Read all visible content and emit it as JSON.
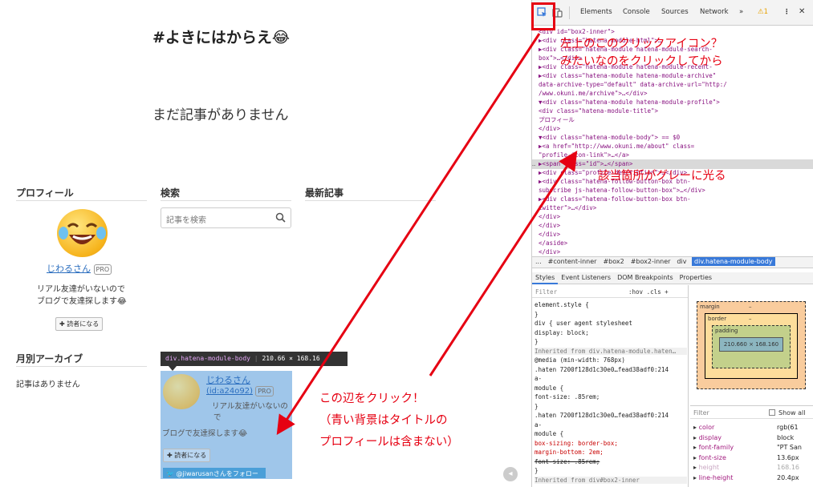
{
  "blog": {
    "title": "#よきにはからえ😂",
    "no_articles": "まだ記事がありません",
    "sidebar": {
      "profile_title": "プロフィール",
      "search_title": "検索",
      "recent_title": "最新記事",
      "user_name": "じわるさん",
      "pro_badge": "PRO",
      "bio_line1": "リアル友達がいないので",
      "bio_line2": "ブログで友達探します😂",
      "reader_button": "✚ 読者になる",
      "search_placeholder": "記事を検索",
      "archive_title": "月別アーカイブ",
      "archive_empty": "記事はありません"
    },
    "highlight": {
      "tooltip_tag": "div.hatena-module-body",
      "tooltip_size": "210.66 × 168.16",
      "user_name": "じわるさん",
      "user_id": "(id:a24o92)",
      "pro_badge": "PRO",
      "bio_line1": "リアル友達がいないの",
      "bio_line2": "で",
      "bio_line3": "ブログで友達探します😂",
      "reader_button": "✚ 読者になる",
      "twitter_button": "🐦 @jiwarusanさんをフォロー"
    }
  },
  "devtools": {
    "tabs": [
      "Elements",
      "Console",
      "Sources",
      "Network",
      "»"
    ],
    "warning_count": "⚠1",
    "code_lines": [
      "  <div id=\"box2-inner\">",
      "    ▶<div class=\"hatena-module-html\">…",
      "    ▶<div class=\"hatena-module hatena-module-search-",
      "    box\">…</div>",
      "    ▶<div class=\"hatena-module hatena-module-recent-",
      "    ▶<div class=\"hatena-module hatena-module-archive\"",
      "    data-archive-type=\"default\" data-archive-url=\"http:/",
      "    /www.okuni.me/archive\">…</div>",
      "    ▼<div class=\"hatena-module hatena-module-profile\">",
      "      <div class=\"hatena-module-title\">",
      "        プロフィール",
      "      </div>",
      "    ▼<div class=\"hatena-module-body\"> == $0",
      "      ▶<a href=\"http://www.okuni.me/about\" class=",
      "      \"profile-icon-link\">…</a>",
      "      ▶<span class=\"id\">…</span>",
      "      ▶<div class=\"profile-description\">…</div>",
      "      ▶<div class=\"hatena-follow-button-box btn-",
      "      subscribe js-hatena-follow-button-box\">…</div>",
      "      ▶<div class=\"hatena-follow-button-box btn-",
      "      twitter\">…</div>",
      "      </div>",
      "    </div>",
      "  </div>",
      "  </aside>",
      "</div>"
    ],
    "breadcrumbs": [
      "...",
      "#content-inner",
      "#box2",
      "#box2-inner",
      "div"
    ],
    "breadcrumb_active": "div.hatena-module-body",
    "style_tabs": [
      "Styles",
      "Event Listeners",
      "DOM Breakpoints",
      "Properties"
    ],
    "filter_label": "Filter",
    "filter_right": ":hov .cls +",
    "styles_lines": [
      "element.style {",
      "}",
      "div {                    user agent stylesheet",
      "   display: block;",
      "}",
      "Inherited from div.hatena-module.haten…",
      "@media (min-width: 768px)",
      ".haten 7200f128d1c30e0…fead38adf0:214",
      "a-",
      "module {",
      "   font-size: .85rem;",
      "}",
      ".haten 7200f128d1c30e0…fead38adf0:214",
      "a-",
      "module {",
      "   box-sizing: border-box;",
      "   margin-bottom: 2em;",
      "   font-size: .85rem;",
      "}",
      "Inherited from div#box2-inner"
    ],
    "box_model": {
      "margin": "margin",
      "border": "border",
      "padding": "padding",
      "content": "210.660 × 168.160",
      "dash": "–"
    },
    "computed": {
      "filter": "Filter",
      "show_all": "Show all",
      "props": [
        {
          "name": "color",
          "value": "rgb(61"
        },
        {
          "name": "display",
          "value": "block"
        },
        {
          "name": "font-family",
          "value": "\"PT San"
        },
        {
          "name": "font-size",
          "value": "13.6px"
        },
        {
          "name": "height",
          "value": "168.16"
        },
        {
          "name": "line-height",
          "value": "20.4px"
        }
      ]
    }
  },
  "annotations": {
    "top_line1": "左上のこのクリックアイコン？",
    "top_line2": "みたいなのをクリックしてから",
    "middle": "該当箇所がグレーに光る",
    "bottom_line1": "この辺をクリック！",
    "bottom_line2": "（青い背景はタイトルの",
    "bottom_line3": "プロフィールは含まない）"
  },
  "colors": {
    "annotation_red": "#e60012",
    "highlight_blue": "#9fc6ea",
    "devtools_accent": "#3879d9"
  }
}
